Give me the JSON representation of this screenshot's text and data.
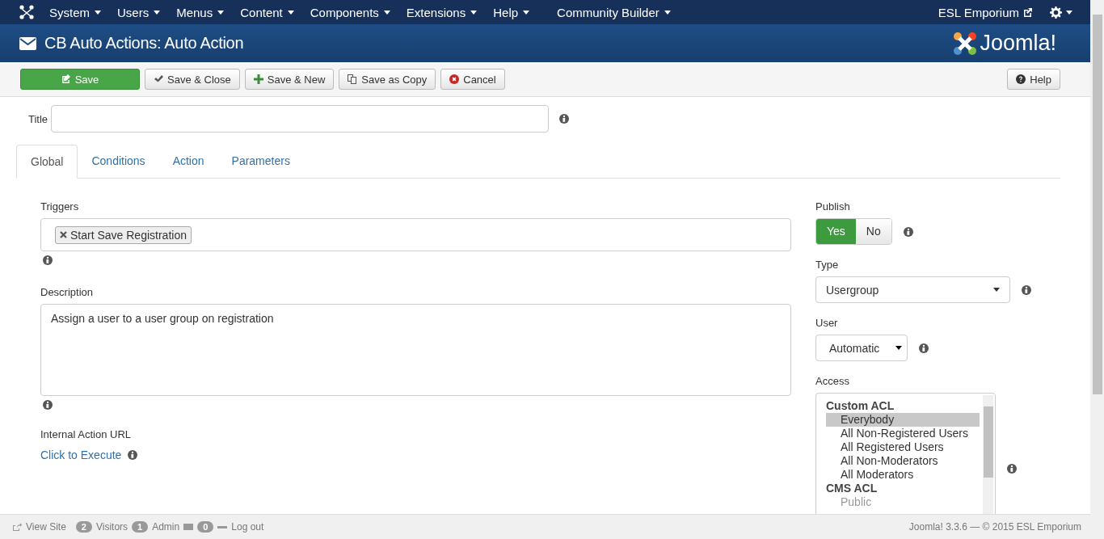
{
  "top_menu": {
    "items": [
      {
        "label": "System"
      },
      {
        "label": "Users"
      },
      {
        "label": "Menus"
      },
      {
        "label": "Content"
      },
      {
        "label": "Components"
      },
      {
        "label": "Extensions"
      },
      {
        "label": "Help"
      },
      {
        "label": "Community Builder"
      }
    ],
    "site_link": "ESL Emporium"
  },
  "header": {
    "title": "CB Auto Actions: Auto Action",
    "brand": "Joomla!"
  },
  "toolbar": {
    "buttons": [
      {
        "label": "Save",
        "kind": "save"
      },
      {
        "label": "Save & Close",
        "kind": "close"
      },
      {
        "label": "Save & New",
        "kind": "new"
      },
      {
        "label": "Save as Copy",
        "kind": "copy"
      },
      {
        "label": "Cancel",
        "kind": "cancel"
      }
    ],
    "help": "Help"
  },
  "form": {
    "title_label": "Title",
    "tabs": [
      {
        "label": "Global",
        "selected": true
      },
      {
        "label": "Conditions",
        "selected": false
      },
      {
        "label": "Action",
        "selected": false
      },
      {
        "label": "Parameters",
        "selected": false
      }
    ],
    "triggers": {
      "label": "Triggers",
      "tags": [
        "Start Save Registration"
      ]
    },
    "description": {
      "label": "Description",
      "value": "Assign a user to a user group on registration"
    },
    "internal_url": {
      "label": "Internal Action URL",
      "link": "Click to Execute"
    },
    "publish": {
      "label": "Publish",
      "options": [
        {
          "label": "Yes",
          "selected": true
        },
        {
          "label": "No",
          "selected": false
        }
      ]
    },
    "type": {
      "label": "Type",
      "value": "Usergroup"
    },
    "user": {
      "label": "User",
      "value": "Automatic"
    },
    "access": {
      "label": "Access",
      "groups": [
        {
          "label": "Custom ACL",
          "options": [
            {
              "label": "Everybody",
              "selected": true,
              "disabled": false
            },
            {
              "label": "All Non-Registered Users",
              "selected": false,
              "disabled": false
            },
            {
              "label": "All Registered Users",
              "selected": false,
              "disabled": false
            },
            {
              "label": "All Non-Moderators",
              "selected": false,
              "disabled": false
            },
            {
              "label": "All Moderators",
              "selected": false,
              "disabled": false
            }
          ]
        },
        {
          "label": "CMS ACL",
          "options": [
            {
              "label": "Public",
              "selected": false,
              "disabled": true
            }
          ]
        }
      ]
    }
  },
  "footer": {
    "view_site": "View Site",
    "visitors_count": "2",
    "visitors": "Visitors",
    "admin_count": "1",
    "admin": "Admin",
    "messages_count": "0",
    "logout": "Log out",
    "version": "Joomla! 3.3.6 — © 2015 ESL Emporium"
  }
}
